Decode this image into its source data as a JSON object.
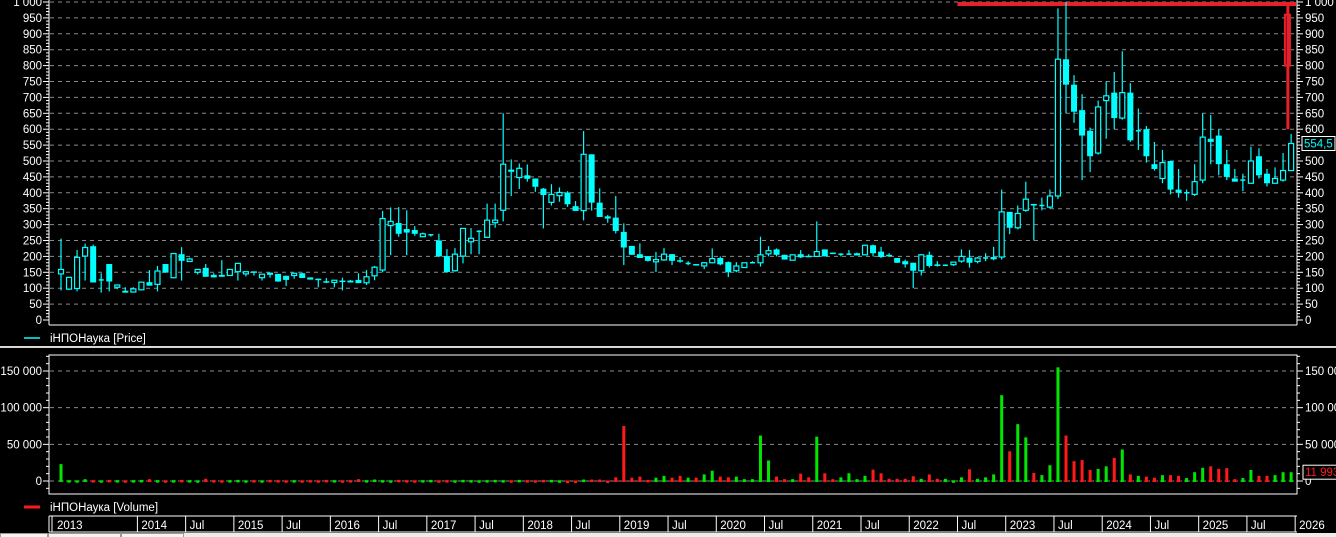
{
  "colors": {
    "candle": "#00ffff",
    "up_volume": "#00e600",
    "down_volume": "#ff1a1a",
    "overlay": "#e8202a",
    "grid": "#8a8a8a",
    "axis": "#ffffff"
  },
  "legend": {
    "price": "iНПОНаука [Price]",
    "volume": "iНПОНаука [Volume]"
  },
  "last_price_label": "554,5",
  "last_volume_label": "11 993",
  "time_axis": {
    "start_month": "2013-03",
    "labels": [
      {
        "label": "2013",
        "index": -1
      },
      {
        "label": "2014",
        "index": 10
      },
      {
        "label": "Jul",
        "index": 16
      },
      {
        "label": "2015",
        "index": 22
      },
      {
        "label": "Jul",
        "index": 28
      },
      {
        "label": "2016",
        "index": 34
      },
      {
        "label": "Jul",
        "index": 40
      },
      {
        "label": "2017",
        "index": 46
      },
      {
        "label": "Jul",
        "index": 52
      },
      {
        "label": "2018",
        "index": 58
      },
      {
        "label": "Jul",
        "index": 64
      },
      {
        "label": "2019",
        "index": 70
      },
      {
        "label": "Jul",
        "index": 76
      },
      {
        "label": "2020",
        "index": 82
      },
      {
        "label": "Jul",
        "index": 88
      },
      {
        "label": "2021",
        "index": 94
      },
      {
        "label": "Jul",
        "index": 100
      },
      {
        "label": "2022",
        "index": 106
      },
      {
        "label": "Jul",
        "index": 112
      },
      {
        "label": "2023",
        "index": 118
      },
      {
        "label": "Jul",
        "index": 124
      },
      {
        "label": "2024",
        "index": 130
      },
      {
        "label": "Jul",
        "index": 136
      },
      {
        "label": "2025",
        "index": 142
      },
      {
        "label": "Jul",
        "index": 148
      },
      {
        "label": "2026",
        "index": 154
      }
    ]
  },
  "chart_data": [
    {
      "type": "candlestick",
      "title": "iНПОНаука [Price]",
      "interval": "monthly",
      "ylim": [
        0,
        1000
      ],
      "y_ticks": [
        {
          "v": 0,
          "label": "0"
        },
        {
          "v": 50,
          "label": "50"
        },
        {
          "v": 100,
          "label": "100"
        },
        {
          "v": 150,
          "label": "150"
        },
        {
          "v": 200,
          "label": "200"
        },
        {
          "v": 250,
          "label": "250"
        },
        {
          "v": 300,
          "label": "300"
        },
        {
          "v": 350,
          "label": "350"
        },
        {
          "v": 400,
          "label": "400"
        },
        {
          "v": 450,
          "label": "450"
        },
        {
          "v": 500,
          "label": "500"
        },
        {
          "v": 550,
          "label": "550"
        },
        {
          "v": 600,
          "label": "600"
        },
        {
          "v": 650,
          "label": "650"
        },
        {
          "v": 700,
          "label": "700"
        },
        {
          "v": 750,
          "label": "750"
        },
        {
          "v": 800,
          "label": "800"
        },
        {
          "v": 850,
          "label": "850"
        },
        {
          "v": 900,
          "label": "900"
        },
        {
          "v": 950,
          "label": "950"
        },
        {
          "v": 1000,
          "label": "1 000"
        }
      ],
      "grid": true,
      "ohlc": [
        [
          145,
          256,
          93,
          159
        ],
        [
          97,
          136,
          95,
          134
        ],
        [
          99,
          220,
          90,
          197
        ],
        [
          201,
          240,
          124,
          228
        ],
        [
          232,
          237,
          118,
          118
        ],
        [
          126,
          147,
          86,
          126
        ],
        [
          176,
          176,
          90,
          121
        ],
        [
          103,
          112,
          97,
          110
        ],
        [
          92,
          103,
          86,
          86
        ],
        [
          88,
          103,
          86,
          98
        ],
        [
          95,
          120,
          93,
          119
        ],
        [
          119,
          157,
          108,
          108
        ],
        [
          112,
          170,
          90,
          154
        ],
        [
          176,
          176,
          149,
          149
        ],
        [
          133,
          209,
          133,
          209
        ],
        [
          207,
          229,
          124,
          186
        ],
        [
          184,
          196,
          184,
          192
        ],
        [
          150,
          159,
          143,
          159
        ],
        [
          164,
          176,
          136,
          136
        ],
        [
          142,
          147,
          134,
          134
        ],
        [
          142,
          188,
          136,
          136
        ],
        [
          140,
          159,
          140,
          159
        ],
        [
          152,
          178,
          124,
          178
        ],
        [
          145,
          152,
          137,
          152
        ],
        [
          153,
          153,
          140,
          152
        ],
        [
          133,
          144,
          124,
          144
        ],
        [
          149,
          149,
          133,
          142
        ],
        [
          145,
          145,
          120,
          121
        ],
        [
          139,
          140,
          107,
          126
        ],
        [
          140,
          147,
          130,
          147
        ],
        [
          147,
          149,
          132,
          132
        ],
        [
          134,
          134,
          127,
          127
        ],
        [
          130,
          130,
          103,
          128
        ],
        [
          122,
          132,
          116,
          118
        ],
        [
          118,
          125,
          103,
          125
        ],
        [
          124,
          133,
          93,
          120
        ],
        [
          124,
          126,
          118,
          118
        ],
        [
          126,
          147,
          116,
          116
        ],
        [
          117,
          157,
          110,
          136
        ],
        [
          139,
          170,
          125,
          166
        ],
        [
          157,
          343,
          150,
          319
        ],
        [
          297,
          354,
          204,
          310
        ],
        [
          305,
          355,
          262,
          271
        ],
        [
          286,
          345,
          204,
          275
        ],
        [
          283,
          295,
          265,
          271
        ],
        [
          262,
          275,
          260,
          271
        ],
        [
          268,
          270,
          262,
          268
        ],
        [
          250,
          271,
          198,
          200
        ],
        [
          201,
          223,
          148,
          151
        ],
        [
          155,
          226,
          152,
          207
        ],
        [
          201,
          288,
          178,
          288
        ],
        [
          246,
          289,
          207,
          257
        ],
        [
          279,
          282,
          207,
          279
        ],
        [
          260,
          366,
          258,
          314
        ],
        [
          306,
          366,
          290,
          314
        ],
        [
          345,
          650,
          310,
          490
        ],
        [
          473,
          505,
          390,
          466
        ],
        [
          448,
          492,
          412,
          477
        ],
        [
          455,
          489,
          435,
          444
        ],
        [
          445,
          445,
          403,
          419
        ],
        [
          413,
          415,
          288,
          393
        ],
        [
          370,
          427,
          360,
          395
        ],
        [
          391,
          417,
          372,
          401
        ],
        [
          401,
          405,
          356,
          364
        ],
        [
          358,
          374,
          343,
          343
        ],
        [
          344,
          594,
          313,
          521
        ],
        [
          521,
          521,
          344,
          369
        ],
        [
          369,
          414,
          324,
          324
        ],
        [
          326,
          330,
          306,
          319
        ],
        [
          322,
          390,
          272,
          280
        ],
        [
          277,
          304,
          173,
          228
        ],
        [
          233,
          233,
          205,
          205
        ],
        [
          207,
          241,
          195,
          195
        ],
        [
          201,
          201,
          184,
          186
        ],
        [
          183,
          214,
          151,
          190
        ],
        [
          189,
          226,
          186,
          207
        ],
        [
          207,
          207,
          173,
          186
        ],
        [
          188,
          198,
          180,
          186
        ],
        [
          178,
          185,
          172,
          178
        ],
        [
          176,
          176,
          172,
          172
        ],
        [
          170,
          182,
          160,
          180
        ],
        [
          180,
          225,
          178,
          193
        ],
        [
          195,
          200,
          172,
          175
        ],
        [
          182,
          184,
          135,
          150
        ],
        [
          155,
          182,
          150,
          170
        ],
        [
          165,
          180,
          165,
          180
        ],
        [
          180,
          185,
          178,
          180
        ],
        [
          180,
          262,
          168,
          205
        ],
        [
          208,
          232,
          200,
          218
        ],
        [
          222,
          225,
          200,
          205
        ],
        [
          205,
          205,
          190,
          190
        ],
        [
          188,
          205,
          188,
          205
        ],
        [
          207,
          220,
          195,
          197
        ],
        [
          202,
          207,
          198,
          200
        ],
        [
          200,
          310,
          198,
          215
        ],
        [
          222,
          222,
          200,
          200
        ],
        [
          212,
          212,
          207,
          208
        ],
        [
          207,
          210,
          200,
          207
        ],
        [
          207,
          220,
          205,
          207
        ],
        [
          207,
          212,
          204,
          208
        ],
        [
          205,
          237,
          205,
          235
        ],
        [
          235,
          237,
          200,
          210
        ],
        [
          215,
          230,
          195,
          198
        ],
        [
          205,
          210,
          198,
          200
        ],
        [
          195,
          195,
          180,
          180
        ],
        [
          185,
          190,
          165,
          175
        ],
        [
          180,
          180,
          100,
          155
        ],
        [
          155,
          208,
          140,
          205
        ],
        [
          205,
          215,
          165,
          170
        ],
        [
          175,
          185,
          168,
          170
        ],
        [
          172,
          175,
          170,
          172
        ],
        [
          174,
          182,
          170,
          182
        ],
        [
          185,
          222,
          180,
          200
        ],
        [
          196,
          220,
          165,
          180
        ],
        [
          184,
          198,
          178,
          195
        ],
        [
          195,
          210,
          185,
          195
        ],
        [
          194,
          230,
          188,
          196
        ],
        [
          198,
          410,
          190,
          340
        ],
        [
          340,
          340,
          270,
          290
        ],
        [
          290,
          360,
          285,
          335
        ],
        [
          345,
          435,
          340,
          380
        ],
        [
          365,
          365,
          250,
          360
        ],
        [
          360,
          385,
          345,
          360
        ],
        [
          355,
          410,
          350,
          390
        ],
        [
          390,
          980,
          380,
          820
        ],
        [
          820,
          1000,
          650,
          740
        ],
        [
          740,
          770,
          620,
          655
        ],
        [
          660,
          710,
          440,
          580
        ],
        [
          595,
          605,
          465,
          515
        ],
        [
          525,
          690,
          520,
          670
        ],
        [
          690,
          750,
          570,
          705
        ],
        [
          715,
          780,
          600,
          635
        ],
        [
          635,
          845,
          630,
          715
        ],
        [
          715,
          745,
          560,
          565
        ],
        [
          595,
          665,
          535,
          595
        ],
        [
          600,
          610,
          495,
          515
        ],
        [
          490,
          560,
          470,
          475
        ],
        [
          445,
          535,
          430,
          495
        ],
        [
          500,
          500,
          395,
          410
        ],
        [
          410,
          475,
          385,
          400
        ],
        [
          400,
          410,
          375,
          400
        ],
        [
          395,
          490,
          390,
          435
        ],
        [
          440,
          650,
          430,
          575
        ],
        [
          570,
          645,
          490,
          560
        ],
        [
          580,
          600,
          455,
          490
        ],
        [
          490,
          535,
          440,
          450
        ],
        [
          445,
          475,
          435,
          435
        ],
        [
          440,
          460,
          405,
          440
        ],
        [
          430,
          545,
          430,
          500
        ],
        [
          515,
          540,
          445,
          455
        ],
        [
          460,
          475,
          420,
          430
        ],
        [
          430,
          480,
          430,
          445
        ],
        [
          440,
          525,
          435,
          470
        ],
        [
          470,
          585,
          470,
          555
        ]
      ],
      "overlay": {
        "level": 1000,
        "from_index": 111.5,
        "candle_index": 152.6,
        "candle": [
          800,
          1000,
          600,
          960
        ]
      }
    },
    {
      "type": "bar",
      "title": "iНПОНаука [Volume]",
      "ylim": [
        0,
        170000
      ],
      "y_ticks": [
        {
          "v": 0,
          "label": "0"
        },
        {
          "v": 50000,
          "label": "50 000"
        },
        {
          "v": 100000,
          "label": "100 000"
        },
        {
          "v": 150000,
          "label": "150 000"
        }
      ],
      "grid": true,
      "values": [
        23000,
        1200,
        1000,
        2500,
        1200,
        1000,
        1500,
        1200,
        1000,
        1200,
        1500,
        2500,
        1200,
        1000,
        1200,
        1500,
        1200,
        1000,
        3000,
        1200,
        1000,
        1200,
        1500,
        1000,
        1200,
        1000,
        1500,
        1200,
        1000,
        1200,
        1000,
        1200,
        1000,
        1500,
        1200,
        1000,
        1200,
        2500,
        1200,
        2000,
        1200,
        1000,
        1500,
        1200,
        1000,
        1200,
        1500,
        1000,
        1200,
        1000,
        1500,
        1200,
        1000,
        1200,
        1500,
        1200,
        1000,
        1500,
        1200,
        1000,
        1500,
        1500,
        1000,
        500,
        500,
        2000,
        2000,
        2000,
        500,
        5000,
        75000,
        4500,
        6000,
        1500,
        4500,
        7000,
        4500,
        7000,
        4500,
        4500,
        9000,
        14000,
        6000,
        5000,
        6000,
        2500,
        2500,
        62000,
        28000,
        6000,
        2500,
        2500,
        10000,
        5000,
        60500,
        10500,
        2500,
        5000,
        10500,
        2500,
        7000,
        15500,
        10500,
        3000,
        3000,
        3000,
        6500,
        3000,
        9000,
        3000,
        3000,
        1000,
        5000,
        16000,
        3000,
        5000,
        9000,
        117000,
        40500,
        77500,
        59500,
        11000,
        8000,
        21500,
        155000,
        62000,
        27000,
        28500,
        15000,
        16500,
        20000,
        31500,
        43000,
        9000,
        7000,
        6000,
        4500,
        8000,
        8000,
        7000,
        4000,
        12000,
        18000,
        20000,
        16500,
        17500,
        2500,
        4000,
        15000,
        7000,
        7000,
        8000,
        12000,
        11993
      ]
    }
  ]
}
